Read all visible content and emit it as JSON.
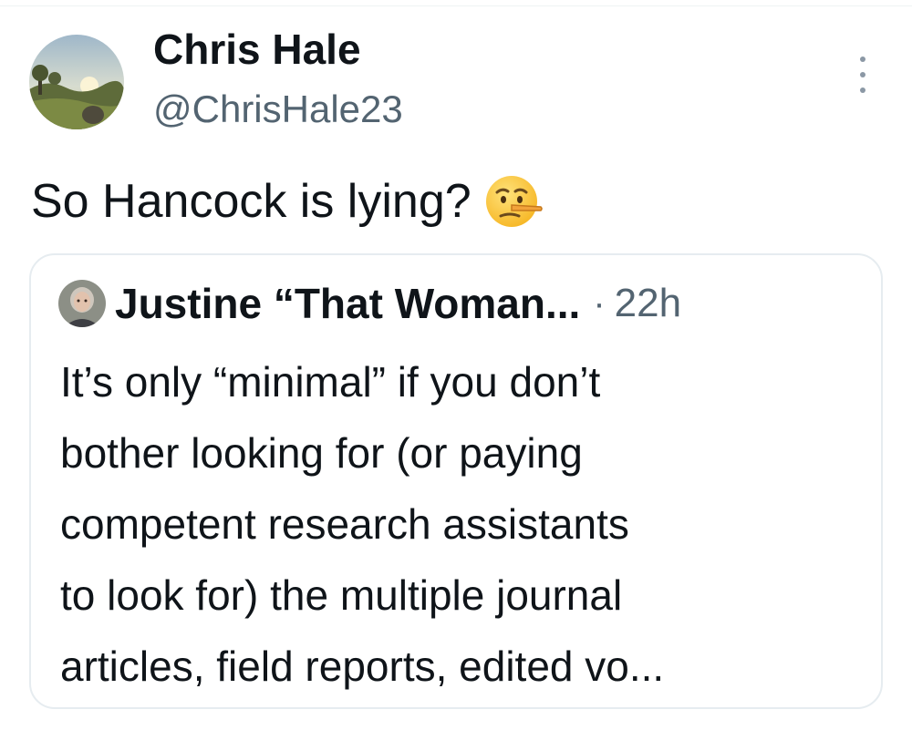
{
  "tweet": {
    "author": {
      "display_name": "Chris Hale",
      "handle": "@ChrisHale23",
      "avatar_icon": "profile-photo-landscape"
    },
    "more_icon": "more-options-icon",
    "text": "So Hancock is lying?",
    "emoji": "lying-face-emoji"
  },
  "quoted_tweet": {
    "author": {
      "display_name": "Justine “That Woman...",
      "avatar_icon": "profile-photo-portrait"
    },
    "separator": "·",
    "time": "22h",
    "text_lines": [
      "It’s only “minimal” if you don’t",
      "bother looking for (or paying",
      "competent research assistants",
      "to look for) the multiple journal",
      "articles, field reports, edited vo..."
    ]
  },
  "colors": {
    "text_primary": "#0f1419",
    "text_secondary": "#536471",
    "border": "#e6ecf0"
  }
}
